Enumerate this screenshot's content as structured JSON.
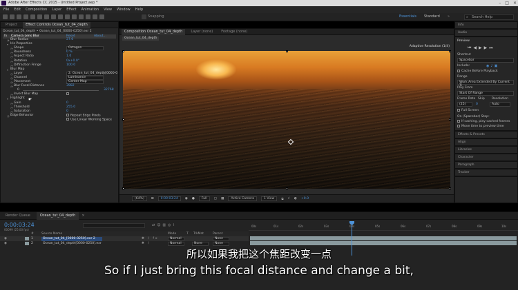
{
  "titlebar": {
    "title": "Adobe After Effects CC 2015 - Untitled Project.aep *"
  },
  "menu": [
    "File",
    "Edit",
    "Composition",
    "Layer",
    "Effect",
    "Animation",
    "View",
    "Window",
    "Help"
  ],
  "toolbar": {
    "snapping": "Snapping",
    "workspaces": [
      "Essentials",
      "Standard"
    ],
    "search_placeholder": "Search Help"
  },
  "left_tabs": [
    "Project",
    "Effect Controls Ocean_tut_04_depth"
  ],
  "effect_controls": {
    "header": "Ocean_tut_04_depth • Ocean_tut_04_[0000-0250].exr 2",
    "effect_name": "Camera Lens Blur",
    "reset": "Reset",
    "about": "About...",
    "rows": [
      {
        "label": "Blur Radius",
        "value": "27.6",
        "kind": "num",
        "indent": 1
      },
      {
        "label": "Iris Properties",
        "value": "",
        "kind": "group",
        "indent": 1
      },
      {
        "label": "Shape",
        "value": "Octagon",
        "kind": "dd",
        "indent": 2
      },
      {
        "label": "Roundness",
        "value": "0 %",
        "kind": "num",
        "indent": 2
      },
      {
        "label": "Aspect Ratio",
        "value": "1.0",
        "kind": "num",
        "indent": 2
      },
      {
        "label": "Rotation",
        "value": "0x+0.0°",
        "kind": "num",
        "indent": 2
      },
      {
        "label": "Diffraction Fringe",
        "value": "100.0",
        "kind": "num",
        "indent": 2
      },
      {
        "label": "Blur Map",
        "value": "",
        "kind": "group",
        "indent": 1
      },
      {
        "label": "Layer",
        "value": "2. Ocean_tut_04_depth[0000-0",
        "kind": "dd",
        "indent": 2
      },
      {
        "label": "Channel",
        "value": "Luminance",
        "kind": "dd",
        "indent": 2
      },
      {
        "label": "Placement",
        "value": "Center Map",
        "kind": "dd",
        "indent": 2
      },
      {
        "label": "Blur Focal Distance",
        "value": "3982",
        "kind": "num",
        "indent": 2
      },
      {
        "label": "0",
        "value": "32768",
        "kind": "range",
        "indent": 3
      },
      {
        "label": "Invert Blur Map",
        "value": "",
        "kind": "check",
        "indent": 2
      },
      {
        "label": "Highlight",
        "value": "",
        "kind": "group",
        "indent": 1
      },
      {
        "label": "Gain",
        "value": "0",
        "kind": "num",
        "indent": 2
      },
      {
        "label": "Threshold",
        "value": "255.0",
        "kind": "num",
        "indent": 2
      },
      {
        "label": "Saturation",
        "value": "0",
        "kind": "num",
        "indent": 2
      },
      {
        "label": "Edge Behavior",
        "value": "Repeat Edge Pixels",
        "kind": "check",
        "indent": 1
      },
      {
        "label": "",
        "value": "Use Linear Working Space",
        "kind": "check",
        "indent": 1
      }
    ]
  },
  "viewer": {
    "tabs": [
      "Composition Ocean_tut_04_depth",
      "Layer (none)",
      "Footage (none)"
    ],
    "comp_tab": "Ocean_tut_04_depth",
    "adaptive": "Adaptive Resolution (1/4)",
    "zoom": "(64%)",
    "timecode": "0:00:03:24",
    "resolution": "Full",
    "camera": "Active Camera",
    "views": "1 View",
    "exposure": "+0.0"
  },
  "right_panel": {
    "collapsed_top": [
      "Info",
      "Audio"
    ],
    "preview_title": "Preview",
    "shortcut_label": "Shortcut",
    "shortcut": "Spacebar",
    "include_label": "Include:",
    "cache": "Cache Before Playback",
    "range_label": "Range",
    "range": "Work Area Extended By Current Ti",
    "play_from_label": "Play From",
    "play_from": "Start Of Range",
    "frame_rate_label": "Frame Rate",
    "skip_label": "Skip",
    "resolution_label": "Resolution",
    "frame_rate": "(25)",
    "skip": "0",
    "resolution": "Auto",
    "full_screen": "Full Screen",
    "on_stop": "On (Spacebar) Stop:",
    "if_caching": "If caching, play cached frames",
    "move_time": "Move time to preview time",
    "sections": [
      "Effects & Presets",
      "Align",
      "Libraries",
      "Character",
      "Paragraph",
      "Tracker"
    ]
  },
  "timeline": {
    "tabs": [
      "Render Queue",
      "Ocean_tut_04_depth"
    ],
    "timecode": "0:00:03:24",
    "frames": "00099 (25.00 fps)",
    "ticks": [
      "00s",
      "01s",
      "02s",
      "03s",
      "04s",
      "05s",
      "06s",
      "07s",
      "08s",
      "09s",
      "10s"
    ],
    "columns": [
      "#",
      "Source Name",
      "Mode",
      "T",
      "TrkMat",
      "Parent"
    ],
    "layers": [
      {
        "num": "1",
        "name": "Ocean_tut_04_[0000-0250].exr 2",
        "mode": "Normal",
        "trkmat": "",
        "parent": "None"
      },
      {
        "num": "2",
        "name": "Ocean_tut_04_depth[0000-0250].exr",
        "mode": "Normal",
        "trkmat": "None",
        "parent": "None"
      }
    ]
  },
  "subtitles": {
    "zh": "所以如果我把这个焦距改变一点",
    "en": "So if I just bring this focal distance and change a bit,"
  }
}
